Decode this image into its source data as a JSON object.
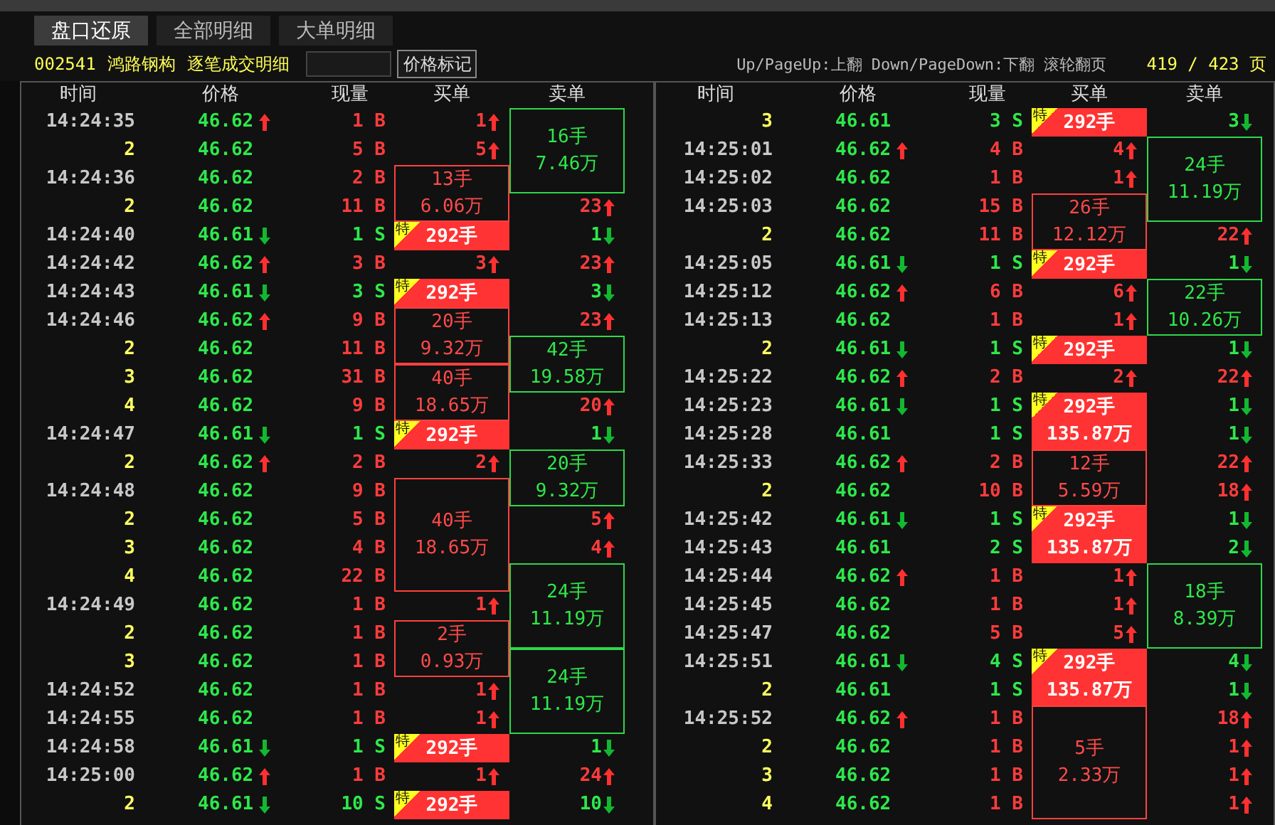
{
  "tabs": [
    {
      "label": "盘口还原",
      "selected": true
    },
    {
      "label": "全部明细",
      "selected": false
    },
    {
      "label": "大单明细",
      "selected": false
    }
  ],
  "info": {
    "code": "002541",
    "name": "鸿路钢构",
    "title": "逐笔成交明细",
    "button": "价格标记",
    "hint": "Up/PageUp:上翻 Down/PageDown:下翻 滚轮翻页",
    "page": "419 / 423 页"
  },
  "panels": [
    {
      "headers": [
        "时间",
        "价格",
        "现量",
        "买单",
        "卖单"
      ],
      "rows": [
        {
          "kind": "time",
          "time": "14:24:35",
          "price": "46.62",
          "up": true,
          "down": false,
          "volume": "1",
          "side": "B",
          "buy": {
            "kind": "single",
            "value": "1",
            "up": true
          },
          "sell": {
            "kind": "block",
            "lots": "16手",
            "amount": "7.46万"
          }
        },
        {
          "kind": "seq",
          "time": "2",
          "price": "46.62",
          "up": false,
          "down": false,
          "volume": "5",
          "side": "B",
          "buy": {
            "kind": "single",
            "value": "5",
            "up": true
          }
        },
        {
          "kind": "time",
          "time": "14:24:36",
          "price": "46.62",
          "up": false,
          "down": false,
          "volume": "2",
          "side": "B",
          "buy": {
            "kind": "block",
            "lots": "13手",
            "amount": "6.06万"
          }
        },
        {
          "kind": "seq",
          "time": "2",
          "price": "46.62",
          "up": false,
          "down": false,
          "volume": "11",
          "side": "B",
          "sell": {
            "kind": "single",
            "value": "23",
            "up": true
          }
        },
        {
          "kind": "time",
          "time": "14:24:40",
          "price": "46.61",
          "up": false,
          "down": true,
          "volume": "1",
          "side": "S",
          "buy": {
            "kind": "special",
            "badge": "特",
            "lots": "292手"
          },
          "sell": {
            "kind": "single",
            "value": "1",
            "up": false
          }
        },
        {
          "kind": "time",
          "time": "14:24:42",
          "price": "46.62",
          "up": true,
          "down": false,
          "volume": "3",
          "side": "B",
          "buy": {
            "kind": "single",
            "value": "3",
            "up": true
          },
          "sell": {
            "kind": "single",
            "value": "23",
            "up": true
          }
        },
        {
          "kind": "time",
          "time": "14:24:43",
          "price": "46.61",
          "up": false,
          "down": true,
          "volume": "3",
          "side": "S",
          "buy": {
            "kind": "special",
            "badge": "特",
            "lots": "292手"
          },
          "sell": {
            "kind": "single",
            "value": "3",
            "up": false
          }
        },
        {
          "kind": "time",
          "time": "14:24:46",
          "price": "46.62",
          "up": true,
          "down": false,
          "volume": "9",
          "side": "B",
          "buy": {
            "kind": "block",
            "lots": "20手",
            "amount": "9.32万"
          },
          "sell": {
            "kind": "single",
            "value": "23",
            "up": true
          }
        },
        {
          "kind": "seq",
          "time": "2",
          "price": "46.62",
          "up": false,
          "down": false,
          "volume": "11",
          "side": "B",
          "sell": {
            "kind": "block",
            "lots": "42手",
            "amount": "19.58万"
          }
        },
        {
          "kind": "seq",
          "time": "3",
          "price": "46.62",
          "up": false,
          "down": false,
          "volume": "31",
          "side": "B",
          "buy": {
            "kind": "block",
            "lots": "40手",
            "amount": "18.65万"
          }
        },
        {
          "kind": "seq",
          "time": "4",
          "price": "46.62",
          "up": false,
          "down": false,
          "volume": "9",
          "side": "B",
          "sell": {
            "kind": "single",
            "value": "20",
            "up": true
          }
        },
        {
          "kind": "time",
          "time": "14:24:47",
          "price": "46.61",
          "up": false,
          "down": true,
          "volume": "1",
          "side": "S",
          "buy": {
            "kind": "special",
            "badge": "特",
            "lots": "292手"
          },
          "sell": {
            "kind": "single",
            "value": "1",
            "up": false
          }
        },
        {
          "kind": "seq",
          "time": "2",
          "price": "46.62",
          "up": true,
          "down": false,
          "volume": "2",
          "side": "B",
          "buy": {
            "kind": "single",
            "value": "2",
            "up": true
          },
          "sell": {
            "kind": "block",
            "lots": "20手",
            "amount": "9.32万"
          }
        },
        {
          "kind": "time",
          "time": "14:24:48",
          "price": "46.62",
          "up": false,
          "down": false,
          "volume": "9",
          "side": "B",
          "buy": {
            "kind": "block",
            "lots": "40手",
            "amount": "18.65万"
          }
        },
        {
          "kind": "seq",
          "time": "2",
          "price": "46.62",
          "up": false,
          "down": false,
          "volume": "5",
          "side": "B",
          "sell": {
            "kind": "single",
            "value": "5",
            "up": true
          }
        },
        {
          "kind": "seq",
          "time": "3",
          "price": "46.62",
          "up": false,
          "down": false,
          "volume": "4",
          "side": "B",
          "sell": {
            "kind": "single",
            "value": "4",
            "up": true
          }
        },
        {
          "kind": "seq",
          "time": "4",
          "price": "46.62",
          "up": false,
          "down": false,
          "volume": "22",
          "side": "B",
          "sell": {
            "kind": "block",
            "lots": "24手",
            "amount": "11.19万"
          }
        },
        {
          "kind": "time",
          "time": "14:24:49",
          "price": "46.62",
          "up": false,
          "down": false,
          "volume": "1",
          "side": "B",
          "buy": {
            "kind": "single",
            "value": "1",
            "up": true
          }
        },
        {
          "kind": "seq",
          "time": "2",
          "price": "46.62",
          "up": false,
          "down": false,
          "volume": "1",
          "side": "B",
          "buy": {
            "kind": "block",
            "lots": "2手",
            "amount": "0.93万"
          }
        },
        {
          "kind": "seq",
          "time": "3",
          "price": "46.62",
          "up": false,
          "down": false,
          "volume": "1",
          "side": "B",
          "sell": {
            "kind": "block",
            "lots": "24手",
            "amount": "11.19万"
          }
        },
        {
          "kind": "time",
          "time": "14:24:52",
          "price": "46.62",
          "up": false,
          "down": false,
          "volume": "1",
          "side": "B",
          "buy": {
            "kind": "single",
            "value": "1",
            "up": true
          }
        },
        {
          "kind": "time",
          "time": "14:24:55",
          "price": "46.62",
          "up": false,
          "down": false,
          "volume": "1",
          "side": "B",
          "buy": {
            "kind": "single",
            "value": "1",
            "up": true
          }
        },
        {
          "kind": "time",
          "time": "14:24:58",
          "price": "46.61",
          "up": false,
          "down": true,
          "volume": "1",
          "side": "S",
          "buy": {
            "kind": "special",
            "badge": "特",
            "lots": "292手"
          },
          "sell": {
            "kind": "single",
            "value": "1",
            "up": false
          }
        },
        {
          "kind": "time",
          "time": "14:25:00",
          "price": "46.62",
          "up": true,
          "down": false,
          "volume": "1",
          "side": "B",
          "buy": {
            "kind": "single",
            "value": "1",
            "up": true
          },
          "sell": {
            "kind": "single",
            "value": "24",
            "up": true
          }
        },
        {
          "kind": "seq",
          "time": "2",
          "price": "46.61",
          "up": false,
          "down": true,
          "volume": "10",
          "side": "S",
          "buy": {
            "kind": "special",
            "badge": "特",
            "lots": "292手"
          },
          "sell": {
            "kind": "single",
            "value": "10",
            "up": false
          }
        }
      ]
    },
    {
      "headers": [
        "时间",
        "价格",
        "现量",
        "买单",
        "卖单"
      ],
      "rows": [
        {
          "kind": "seq",
          "time": "3",
          "price": "46.61",
          "up": false,
          "down": false,
          "volume": "3",
          "side": "S",
          "buy": {
            "kind": "special",
            "badge": "特",
            "lots": "292手"
          },
          "sell": {
            "kind": "single",
            "value": "3",
            "up": false
          }
        },
        {
          "kind": "time",
          "time": "14:25:01",
          "price": "46.62",
          "up": true,
          "down": false,
          "volume": "4",
          "side": "B",
          "buy": {
            "kind": "single",
            "value": "4",
            "up": true
          },
          "sell": {
            "kind": "block",
            "lots": "24手",
            "amount": "11.19万"
          }
        },
        {
          "kind": "time",
          "time": "14:25:02",
          "price": "46.62",
          "up": false,
          "down": false,
          "volume": "1",
          "side": "B",
          "buy": {
            "kind": "single",
            "value": "1",
            "up": true
          }
        },
        {
          "kind": "time",
          "time": "14:25:03",
          "price": "46.62",
          "up": false,
          "down": false,
          "volume": "15",
          "side": "B",
          "buy": {
            "kind": "block",
            "lots": "26手",
            "amount": "12.12万"
          }
        },
        {
          "kind": "seq",
          "time": "2",
          "price": "46.62",
          "up": false,
          "down": false,
          "volume": "11",
          "side": "B",
          "sell": {
            "kind": "single",
            "value": "22",
            "up": true
          }
        },
        {
          "kind": "time",
          "time": "14:25:05",
          "price": "46.61",
          "up": false,
          "down": true,
          "volume": "1",
          "side": "S",
          "buy": {
            "kind": "special",
            "badge": "特",
            "lots": "292手"
          },
          "sell": {
            "kind": "single",
            "value": "1",
            "up": false
          }
        },
        {
          "kind": "time",
          "time": "14:25:12",
          "price": "46.62",
          "up": true,
          "down": false,
          "volume": "6",
          "side": "B",
          "buy": {
            "kind": "single",
            "value": "6",
            "up": true
          },
          "sell": {
            "kind": "block",
            "lots": "22手",
            "amount": "10.26万"
          }
        },
        {
          "kind": "time",
          "time": "14:25:13",
          "price": "46.62",
          "up": false,
          "down": false,
          "volume": "1",
          "side": "B",
          "buy": {
            "kind": "single",
            "value": "1",
            "up": true
          }
        },
        {
          "kind": "seq",
          "time": "2",
          "price": "46.61",
          "up": false,
          "down": true,
          "volume": "1",
          "side": "S",
          "buy": {
            "kind": "special",
            "badge": "特",
            "lots": "292手"
          },
          "sell": {
            "kind": "single",
            "value": "1",
            "up": false
          }
        },
        {
          "kind": "time",
          "time": "14:25:22",
          "price": "46.62",
          "up": true,
          "down": false,
          "volume": "2",
          "side": "B",
          "buy": {
            "kind": "single",
            "value": "2",
            "up": true
          },
          "sell": {
            "kind": "single",
            "value": "22",
            "up": true
          }
        },
        {
          "kind": "time",
          "time": "14:25:23",
          "price": "46.61",
          "up": false,
          "down": true,
          "volume": "1",
          "side": "S",
          "buy": {
            "kind": "special",
            "badge": "特",
            "lots": "292手",
            "amount": "135.87万"
          },
          "sell": {
            "kind": "single",
            "value": "1",
            "up": false
          }
        },
        {
          "kind": "time",
          "time": "14:25:28",
          "price": "46.61",
          "up": false,
          "down": false,
          "volume": "1",
          "side": "S",
          "sell": {
            "kind": "single",
            "value": "1",
            "up": false
          }
        },
        {
          "kind": "time",
          "time": "14:25:33",
          "price": "46.62",
          "up": true,
          "down": false,
          "volume": "2",
          "side": "B",
          "buy": {
            "kind": "block",
            "lots": "12手",
            "amount": "5.59万"
          },
          "sell": {
            "kind": "single",
            "value": "22",
            "up": true
          }
        },
        {
          "kind": "seq",
          "time": "2",
          "price": "46.62",
          "up": false,
          "down": false,
          "volume": "10",
          "side": "B",
          "sell": {
            "kind": "single",
            "value": "18",
            "up": true
          }
        },
        {
          "kind": "time",
          "time": "14:25:42",
          "price": "46.61",
          "up": false,
          "down": true,
          "volume": "1",
          "side": "S",
          "buy": {
            "kind": "special",
            "badge": "特",
            "lots": "292手",
            "amount": "135.87万"
          },
          "sell": {
            "kind": "single",
            "value": "1",
            "up": false
          }
        },
        {
          "kind": "time",
          "time": "14:25:43",
          "price": "46.61",
          "up": false,
          "down": false,
          "volume": "2",
          "side": "S",
          "sell": {
            "kind": "single",
            "value": "2",
            "up": false
          }
        },
        {
          "kind": "time",
          "time": "14:25:44",
          "price": "46.62",
          "up": true,
          "down": false,
          "volume": "1",
          "side": "B",
          "buy": {
            "kind": "single",
            "value": "1",
            "up": true
          },
          "sell": {
            "kind": "block",
            "lots": "18手",
            "amount": "8.39万"
          }
        },
        {
          "kind": "time",
          "time": "14:25:45",
          "price": "46.62",
          "up": false,
          "down": false,
          "volume": "1",
          "side": "B",
          "buy": {
            "kind": "single",
            "value": "1",
            "up": true
          }
        },
        {
          "kind": "time",
          "time": "14:25:47",
          "price": "46.62",
          "up": false,
          "down": false,
          "volume": "5",
          "side": "B",
          "buy": {
            "kind": "single",
            "value": "5",
            "up": true
          }
        },
        {
          "kind": "time",
          "time": "14:25:51",
          "price": "46.61",
          "up": false,
          "down": true,
          "volume": "4",
          "side": "S",
          "buy": {
            "kind": "special",
            "badge": "特",
            "lots": "292手",
            "amount": "135.87万"
          },
          "sell": {
            "kind": "single",
            "value": "4",
            "up": false
          }
        },
        {
          "kind": "seq",
          "time": "2",
          "price": "46.61",
          "up": false,
          "down": false,
          "volume": "1",
          "side": "S",
          "sell": {
            "kind": "single",
            "value": "1",
            "up": false
          }
        },
        {
          "kind": "time",
          "time": "14:25:52",
          "price": "46.62",
          "up": true,
          "down": false,
          "volume": "1",
          "side": "B",
          "buy": {
            "kind": "block",
            "lots": "5手",
            "amount": "2.33万"
          },
          "sell": {
            "kind": "single",
            "value": "18",
            "up": true
          }
        },
        {
          "kind": "seq",
          "time": "2",
          "price": "46.62",
          "up": false,
          "down": false,
          "volume": "1",
          "side": "B",
          "sell": {
            "kind": "single",
            "value": "1",
            "up": true
          }
        },
        {
          "kind": "seq",
          "time": "3",
          "price": "46.62",
          "up": false,
          "down": false,
          "volume": "1",
          "side": "B",
          "sell": {
            "kind": "single",
            "value": "1",
            "up": true
          }
        },
        {
          "kind": "seq",
          "time": "4",
          "price": "46.62",
          "up": false,
          "down": false,
          "volume": "1",
          "side": "B",
          "sell": {
            "kind": "single",
            "value": "1",
            "up": true
          }
        }
      ]
    }
  ]
}
